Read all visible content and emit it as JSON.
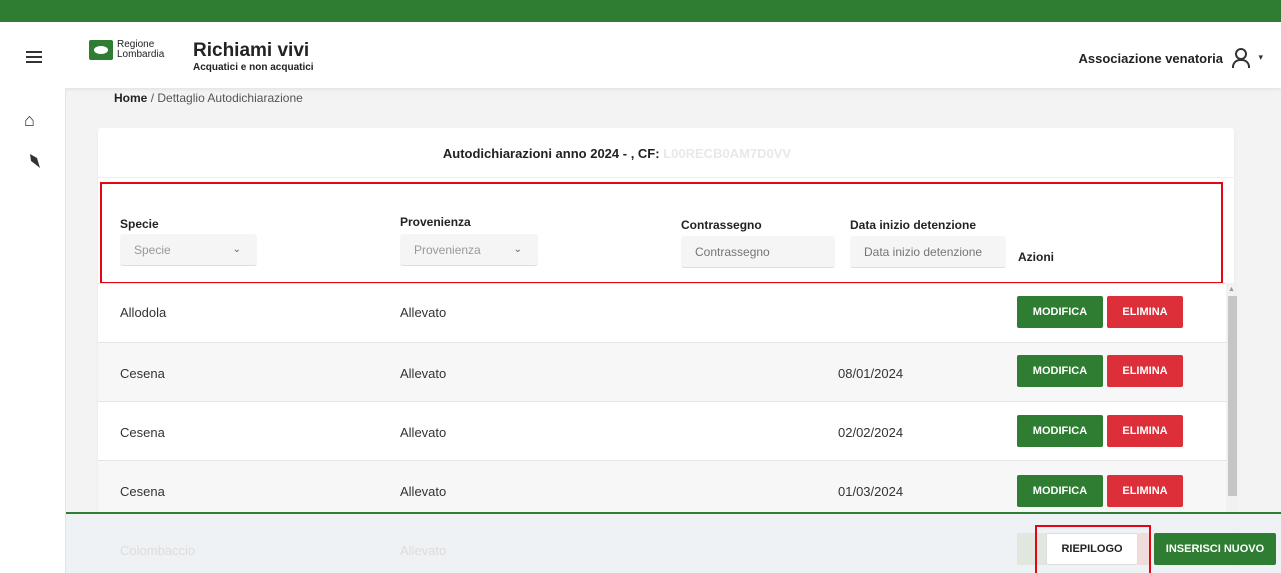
{
  "header": {
    "logo_line1": "Regione",
    "logo_line2": "Lombardia",
    "app_title": "Richiami vivi",
    "app_subtitle": "Acquatici e non acquatici",
    "user_label": "Associazione venatoria",
    "user_caret": "▾"
  },
  "sidebar": {
    "home_icon": "home-icon",
    "bird_icon": "bird-icon"
  },
  "breadcrumb": {
    "home": "Home",
    "separator": "/",
    "current": "Dettaglio Autodichiarazione"
  },
  "card": {
    "title": "Autodichiarazioni anno 2024 - , CF:",
    "cf_value": "L00RECB0AM7D0VV"
  },
  "filters": {
    "specie_label": "Specie",
    "specie_placeholder": "Specie",
    "provenienza_label": "Provenienza",
    "provenienza_placeholder": "Provenienza",
    "contrassegno_label": "Contrassegno",
    "contrassegno_placeholder": "Contrassegno",
    "data_label": "Data inizio detenzione",
    "data_placeholder": "Data inizio detenzione",
    "azioni_label": "Azioni"
  },
  "rows": [
    {
      "specie": "Allodola",
      "provenienza": "Allevato",
      "data": "",
      "modifica": "MODIFICA",
      "elimina": "ELIMINA"
    },
    {
      "specie": "Cesena",
      "provenienza": "Allevato",
      "data": "08/01/2024",
      "modifica": "MODIFICA",
      "elimina": "ELIMINA"
    },
    {
      "specie": "Cesena",
      "provenienza": "Allevato",
      "data": "02/02/2024",
      "modifica": "MODIFICA",
      "elimina": "ELIMINA"
    },
    {
      "specie": "Cesena",
      "provenienza": "Allevato",
      "data": "01/03/2024",
      "modifica": "MODIFICA",
      "elimina": "ELIMINA"
    },
    {
      "specie": "Colombaccio",
      "provenienza": "Allevato",
      "data": "",
      "modifica": "MODIFICA",
      "elimina": "ELIMINA"
    }
  ],
  "footer": {
    "riepilogo": "RIEPILOGO",
    "inserisci": "INSERISCI NUOVO"
  },
  "colors": {
    "primary_green": "#2e7d32",
    "danger_red": "#dc2f3a",
    "highlight_red": "#e30613"
  }
}
